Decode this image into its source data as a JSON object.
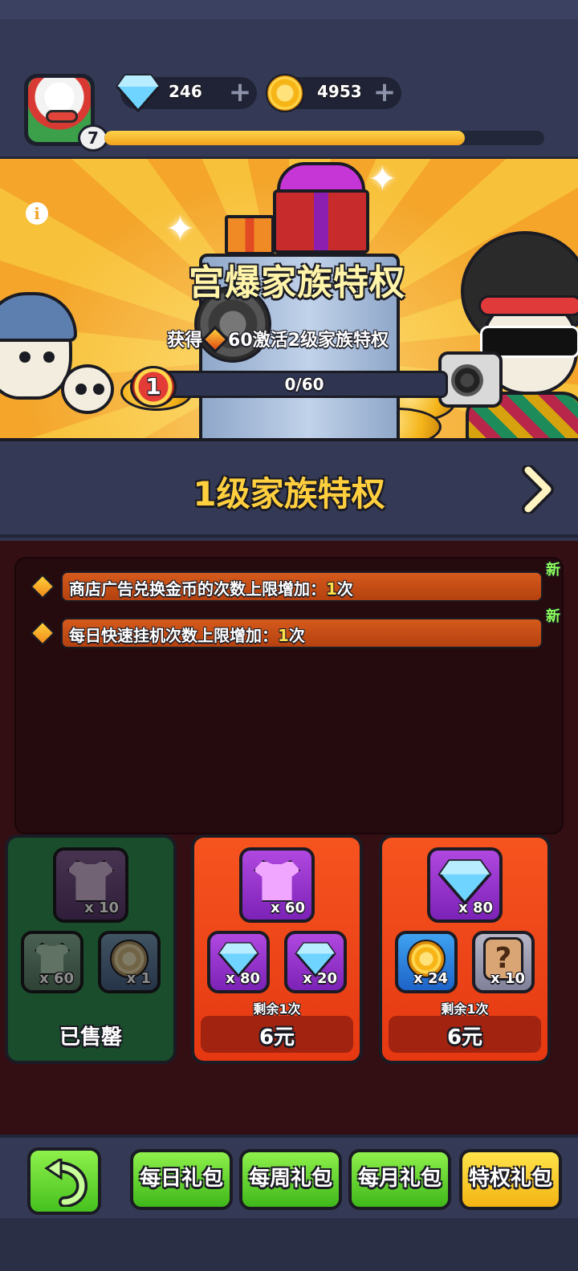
{
  "header": {
    "player_level": "7",
    "xp_progress_fraction": 0.82,
    "gems": "246",
    "coins": "4953",
    "plus_symbol": "+"
  },
  "banner": {
    "info_symbol": "i",
    "title": "宫爆家族特权",
    "subtitle_prefix": "获得",
    "subtitle_suffix": "60激活2级家族特权",
    "tier": "1",
    "progress_text": "0/60",
    "progress_fraction": 0
  },
  "level_header": {
    "title": "1级家族特权"
  },
  "perks": [
    {
      "text": "商店广告兑换金币的次数上限增加：",
      "amount": "1",
      "unit": "次",
      "badge": "新"
    },
    {
      "text": "每日快速挂机次数上限增加：",
      "amount": "1",
      "unit": "次",
      "badge": "新"
    }
  ],
  "packs": [
    {
      "status": "已售罄",
      "items": [
        {
          "icon": "shirt-token-icon",
          "qty": "x 10"
        },
        {
          "icon": "shirt-token-icon",
          "qty": "x 60"
        },
        {
          "icon": "speed-coin-icon",
          "qty": "x 1"
        }
      ]
    },
    {
      "remaining": "剩余1次",
      "price": "6元",
      "items": [
        {
          "icon": "shirt-token-icon",
          "qty": "x 60"
        },
        {
          "icon": "gem-icon",
          "qty": "x 80"
        },
        {
          "icon": "gem-icon",
          "qty": "x 20"
        }
      ]
    },
    {
      "remaining": "剩余1次",
      "price": "6元",
      "items": [
        {
          "icon": "gem-icon",
          "qty": "x 80"
        },
        {
          "icon": "speed-coin-icon",
          "qty": "x 24"
        },
        {
          "icon": "mystery-box-icon",
          "qty": "x 10"
        },
        {
          "icon_text": "?"
        }
      ]
    }
  ],
  "bottom_nav": {
    "tabs": [
      "每日礼包",
      "每周礼包",
      "每月礼包",
      "特权礼包"
    ],
    "active_tab": "特权礼包"
  },
  "colors": {
    "accent_gold": "#ffcf3e",
    "perk_amount": "#ffe04a",
    "new_badge": "#8dff5a",
    "tab_green": "#46c11e",
    "tab_gold": "#f3b414"
  }
}
